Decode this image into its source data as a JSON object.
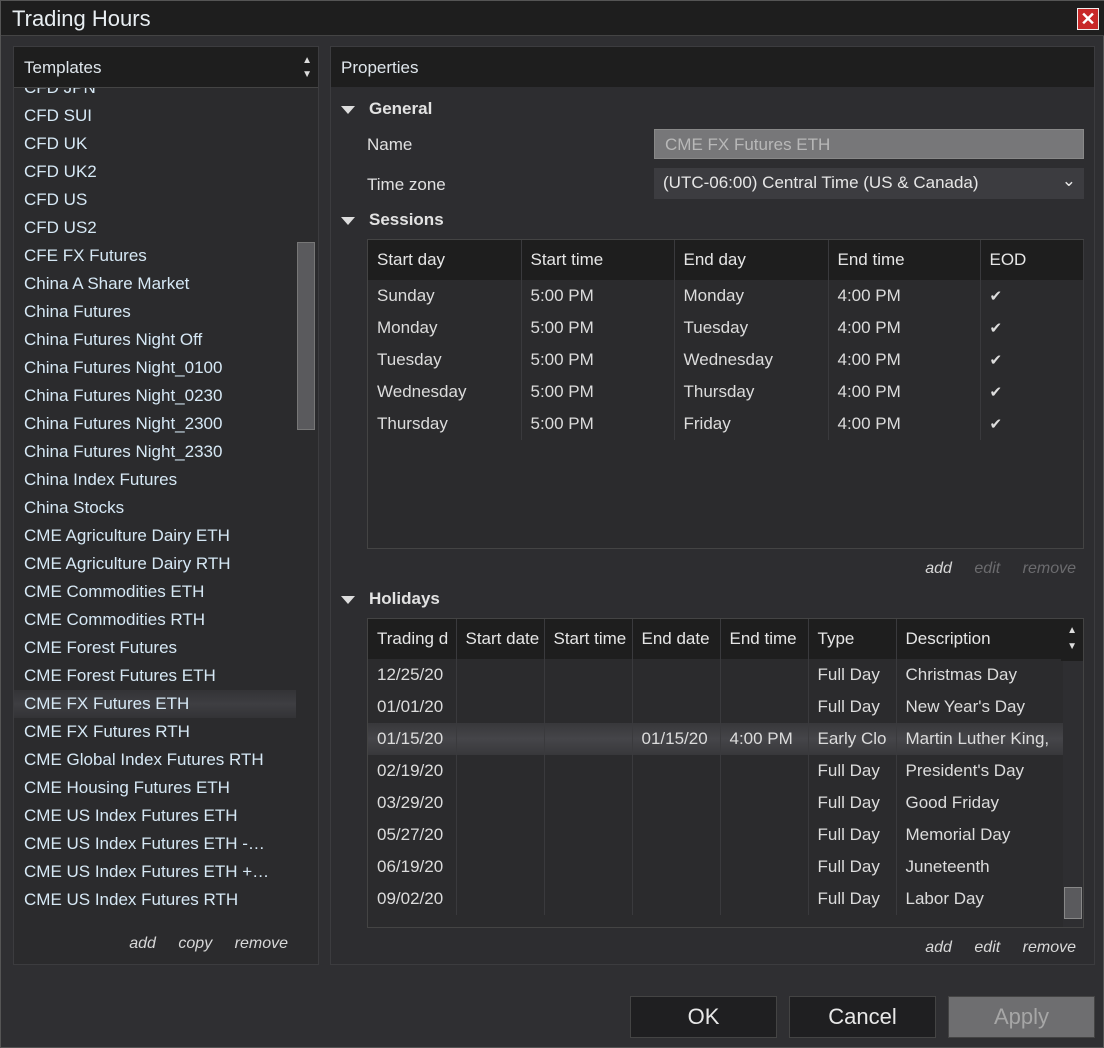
{
  "window": {
    "title": "Trading Hours",
    "close_icon": "close-icon"
  },
  "templates": {
    "header": "Templates",
    "items": [
      "CFD JPN",
      "CFD SUI",
      "CFD UK",
      "CFD UK2",
      "CFD US",
      "CFD US2",
      "CFE FX Futures",
      "China A Share Market",
      "China Futures",
      "China Futures Night Off",
      "China Futures Night_0100",
      "China Futures Night_0230",
      "China Futures Night_2300",
      "China Futures Night_2330",
      "China Index Futures",
      "China Stocks",
      "CME Agriculture Dairy ETH",
      "CME Agriculture Dairy RTH",
      "CME Commodities ETH",
      "CME Commodities RTH",
      "CME Forest Futures",
      "CME Forest Futures ETH",
      "CME FX Futures ETH",
      "CME FX Futures RTH",
      "CME Global Index Futures RTH",
      "CME Housing Futures ETH",
      "CME US Index Futures ETH",
      "CME US Index Futures ETH -…",
      "CME US Index Futures ETH +…",
      "CME US Index Futures RTH"
    ],
    "selected": "CME FX Futures ETH",
    "actions": {
      "add": "add",
      "copy": "copy",
      "remove": "remove"
    }
  },
  "properties": {
    "header": "Properties",
    "general": {
      "title": "General",
      "name_label": "Name",
      "name_value": "CME FX Futures ETH",
      "timezone_label": "Time zone",
      "timezone_value": "(UTC-06:00) Central Time (US & Canada)"
    },
    "sessions": {
      "title": "Sessions",
      "columns": [
        "Start day",
        "Start time",
        "End day",
        "End time",
        "EOD"
      ],
      "rows": [
        [
          "Sunday",
          "5:00 PM",
          "Monday",
          "4:00 PM",
          true
        ],
        [
          "Monday",
          "5:00 PM",
          "Tuesday",
          "4:00 PM",
          true
        ],
        [
          "Tuesday",
          "5:00 PM",
          "Wednesday",
          "4:00 PM",
          true
        ],
        [
          "Wednesday",
          "5:00 PM",
          "Thursday",
          "4:00 PM",
          true
        ],
        [
          "Thursday",
          "5:00 PM",
          "Friday",
          "4:00 PM",
          true
        ]
      ],
      "actions": {
        "add": "add",
        "edit": "edit",
        "remove": "remove"
      }
    },
    "holidays": {
      "title": "Holidays",
      "columns": [
        "Trading d",
        "Start date",
        "Start time",
        "End date",
        "End time",
        "Type",
        "Description"
      ],
      "rows": [
        [
          "12/25/20",
          "",
          "",
          "",
          "",
          "Full Day",
          "Christmas Day"
        ],
        [
          "01/01/20",
          "",
          "",
          "",
          "",
          "Full Day",
          "New Year's Day"
        ],
        [
          "01/15/20",
          "",
          "",
          "01/15/20",
          "4:00 PM",
          "Early Clo",
          "Martin Luther King,"
        ],
        [
          "02/19/20",
          "",
          "",
          "",
          "",
          "Full Day",
          "President's Day"
        ],
        [
          "03/29/20",
          "",
          "",
          "",
          "",
          "Full Day",
          "Good Friday"
        ],
        [
          "05/27/20",
          "",
          "",
          "",
          "",
          "Full Day",
          "Memorial Day"
        ],
        [
          "06/19/20",
          "",
          "",
          "",
          "",
          "Full Day",
          "Juneteenth"
        ],
        [
          "09/02/20",
          "",
          "",
          "",
          "",
          "Full Day",
          "Labor Day"
        ]
      ],
      "actions": {
        "add": "add",
        "edit": "edit",
        "remove": "remove"
      }
    }
  },
  "footer": {
    "ok": "OK",
    "cancel": "Cancel",
    "apply": "Apply"
  }
}
